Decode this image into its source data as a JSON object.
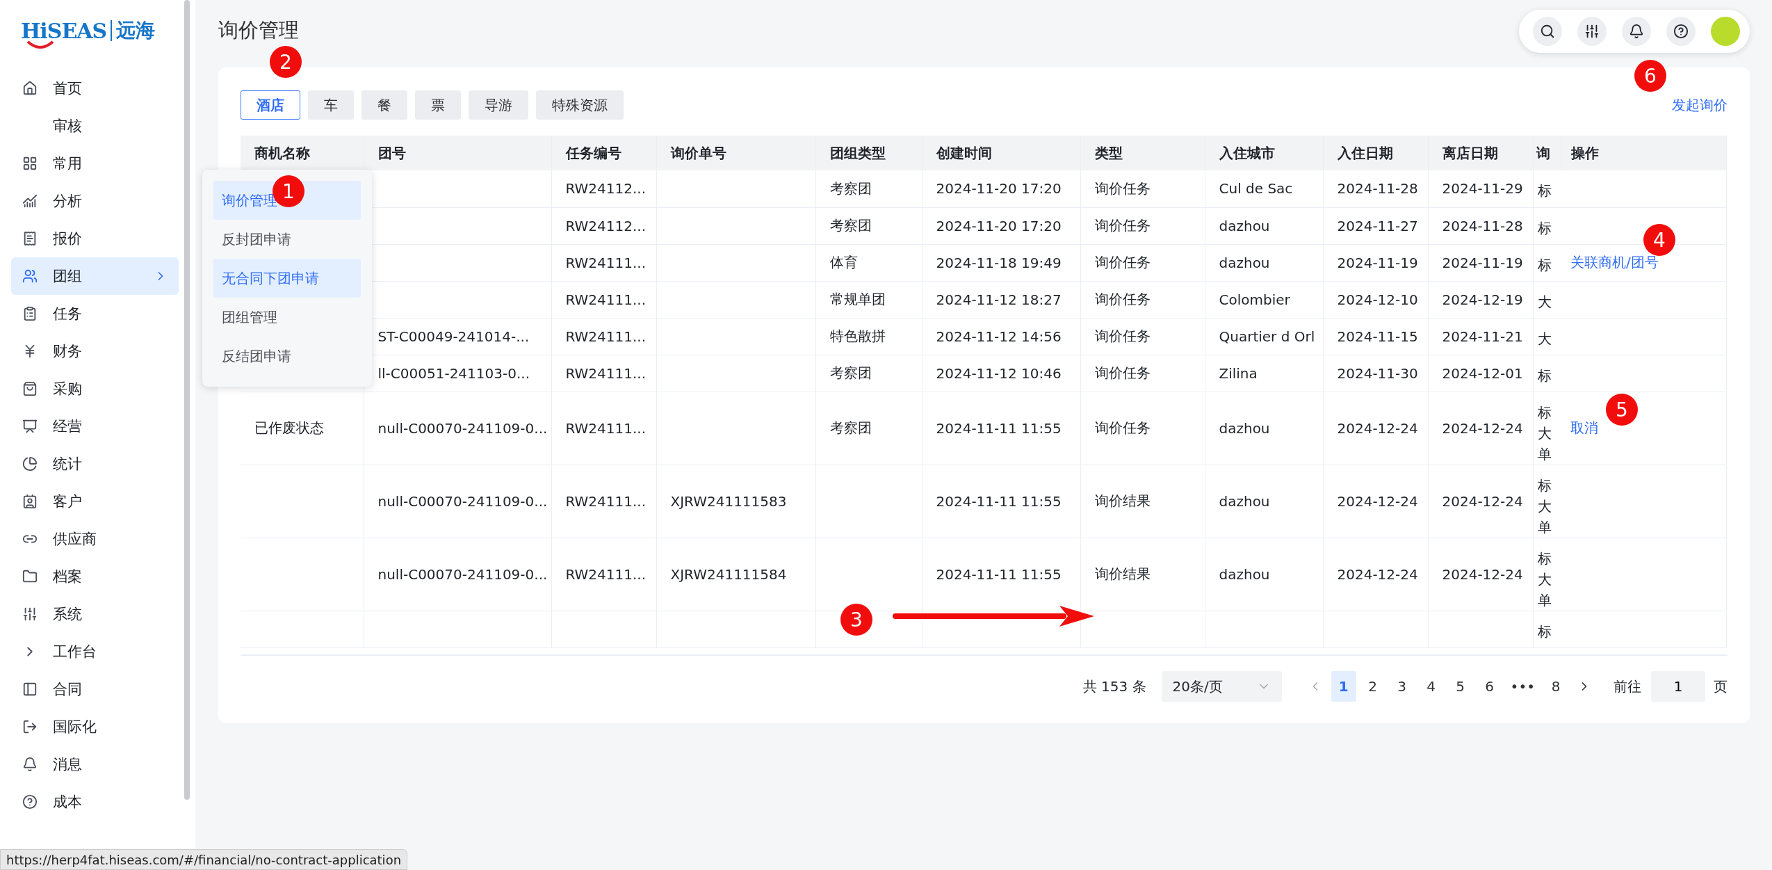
{
  "logo": {
    "brand": "HiSEAS",
    "name": "远海"
  },
  "sidebar": {
    "items": [
      {
        "label": "首页",
        "selected": false
      },
      {
        "label": "审核",
        "selected": false
      },
      {
        "label": "常用",
        "selected": false
      },
      {
        "label": "分析",
        "selected": false
      },
      {
        "label": "报价",
        "selected": false
      },
      {
        "label": "团组",
        "selected": true
      },
      {
        "label": "任务",
        "selected": false
      },
      {
        "label": "财务",
        "selected": false
      },
      {
        "label": "采购",
        "selected": false
      },
      {
        "label": "经营",
        "selected": false
      },
      {
        "label": "统计",
        "selected": false
      },
      {
        "label": "客户",
        "selected": false
      },
      {
        "label": "供应商",
        "selected": false
      },
      {
        "label": "档案",
        "selected": false
      },
      {
        "label": "系统",
        "selected": false
      },
      {
        "label": "工作台",
        "selected": false
      },
      {
        "label": "合同",
        "selected": false
      },
      {
        "label": "国际化",
        "selected": false
      },
      {
        "label": "消息",
        "selected": false
      },
      {
        "label": "成本",
        "selected": false
      }
    ]
  },
  "submenu": {
    "items": [
      {
        "label": "询价管理",
        "selected": true
      },
      {
        "label": "反封团申请",
        "selected": false
      },
      {
        "label": "无合同下团申请",
        "selected": true
      },
      {
        "label": "团组管理",
        "selected": false
      },
      {
        "label": "反结团申请",
        "selected": false
      }
    ]
  },
  "page_title": "询价管理",
  "tabs": [
    {
      "label": "酒店",
      "selected": true
    },
    {
      "label": "车",
      "selected": false
    },
    {
      "label": "餐",
      "selected": false
    },
    {
      "label": "票",
      "selected": false
    },
    {
      "label": "导游",
      "selected": false
    },
    {
      "label": "特殊资源",
      "selected": false
    }
  ],
  "new_inquiry_link": "发起询价",
  "table": {
    "columns": [
      "商机名称",
      "团号",
      "任务编号",
      "询价单号",
      "团组类型",
      "创建时间",
      "类型",
      "入住城市",
      "入住日期",
      "离店日期",
      "询",
      "操作"
    ],
    "rows": [
      {
        "cells": [
          "",
          "",
          "RW24112...",
          "",
          "考察团",
          "2024-11-20 17:20",
          "询价任务",
          "Cul de Sac",
          "2024-11-28",
          "2024-11-29",
          "标",
          ""
        ]
      },
      {
        "cells": [
          "",
          "",
          "RW24112...",
          "",
          "考察团",
          "2024-11-20 17:20",
          "询价任务",
          "dazhou",
          "2024-11-27",
          "2024-11-28",
          "标",
          ""
        ]
      },
      {
        "cells": [
          "",
          "",
          "RW24111...",
          "",
          "体育",
          "2024-11-18 19:49",
          "询价任务",
          "dazhou",
          "2024-11-19",
          "2024-11-19",
          "标",
          "关联商机/团号"
        ]
      },
      {
        "cells": [
          "",
          "",
          "RW24111...",
          "",
          "常规单团",
          "2024-11-12 18:27",
          "询价任务",
          "Colombier",
          "2024-12-10",
          "2024-12-19",
          "大",
          ""
        ]
      },
      {
        "cells": [
          "",
          "ST-C00049-241014-...",
          "RW24111...",
          "",
          "特色散拼",
          "2024-11-12 14:56",
          "询价任务",
          "Quartier d Orl",
          "2024-11-15",
          "2024-11-21",
          "大",
          ""
        ]
      },
      {
        "cells": [
          "",
          "ll-C00051-241103-0...",
          "RW24111...",
          "",
          "考察团",
          "2024-11-12 10:46",
          "询价任务",
          "Zilina",
          "2024-11-30",
          "2024-12-01",
          "标",
          ""
        ]
      },
      {
        "cells": [
          "已作废状态",
          "null-C00070-241109-0...",
          "RW24111...",
          "",
          "考察团",
          "2024-11-11 11:55",
          "询价任务",
          "dazhou",
          "2024-12-24",
          "2024-12-24",
          "标大单",
          "取消"
        ]
      },
      {
        "cells": [
          "",
          "null-C00070-241109-0...",
          "RW24111...",
          "XJRW241111583",
          "",
          "2024-11-11 11:55",
          "询价结果",
          "dazhou",
          "2024-12-24",
          "2024-12-24",
          "标大单",
          ""
        ]
      },
      {
        "cells": [
          "",
          "null-C00070-241109-0...",
          "RW24111...",
          "XJRW241111584",
          "",
          "2024-11-11 11:55",
          "询价结果",
          "dazhou",
          "2024-12-24",
          "2024-12-24",
          "标大单",
          ""
        ]
      },
      {
        "cells": [
          "",
          "",
          "",
          "",
          "",
          "",
          "",
          "",
          "",
          "",
          "标",
          ""
        ]
      }
    ]
  },
  "pagination": {
    "total": "共 153 条",
    "page_size": "20条/页",
    "pages": [
      {
        "label": "1",
        "selected": true
      },
      {
        "label": "2",
        "selected": false
      },
      {
        "label": "3",
        "selected": false
      },
      {
        "label": "4",
        "selected": false
      },
      {
        "label": "5",
        "selected": false
      },
      {
        "label": "6",
        "selected": false
      },
      {
        "label": "•••",
        "selected": false
      },
      {
        "label": "8",
        "selected": false
      }
    ],
    "goto_label": "前往",
    "goto_value": "1",
    "page_unit": "页"
  },
  "annotations": [
    {
      "label": "1"
    },
    {
      "label": "2"
    },
    {
      "label": "3"
    },
    {
      "label": "4"
    },
    {
      "label": "5"
    },
    {
      "label": "6"
    }
  ],
  "status_bar": {
    "url": "https://herp4fat.hiseas.com/#/financial/no-contract-application"
  }
}
